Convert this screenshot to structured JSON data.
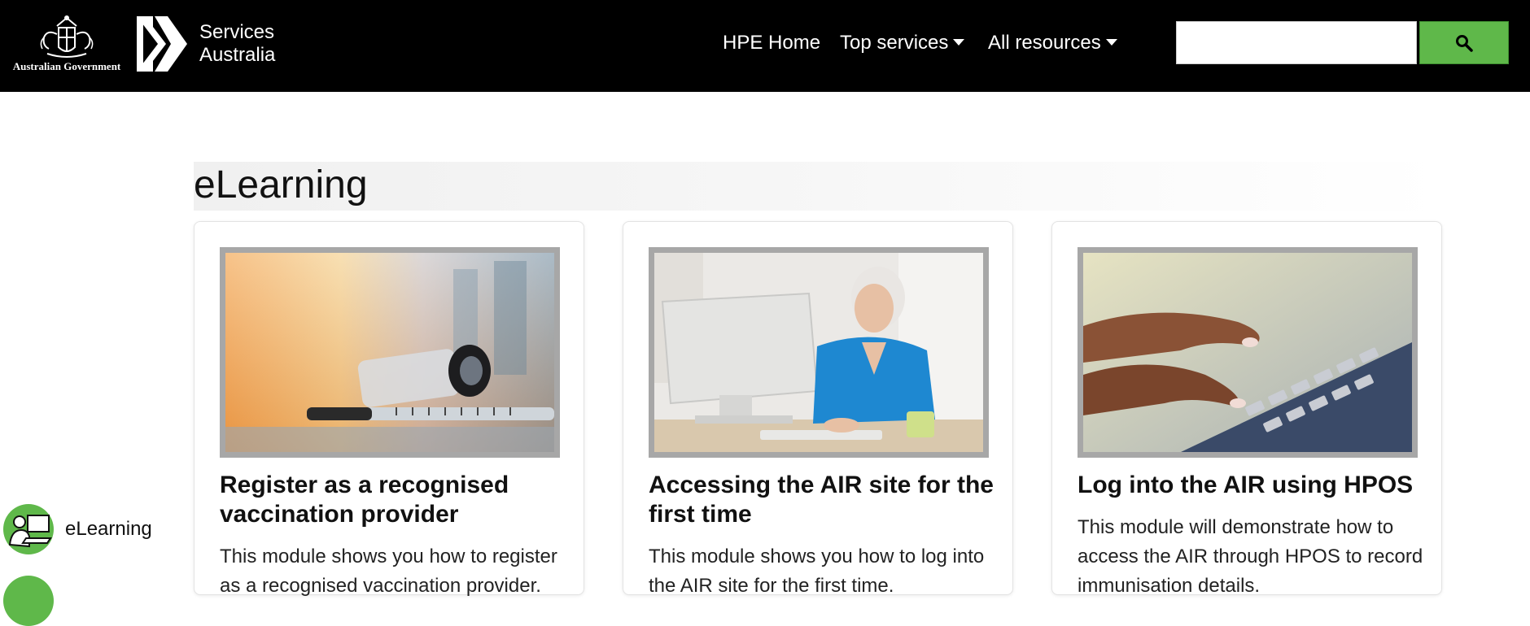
{
  "header": {
    "gov_logo_text": "Australian Government",
    "services_logo_line1": "Services",
    "services_logo_line2": "Australia",
    "nav": [
      {
        "label": "HPE Home",
        "dropdown": false
      },
      {
        "label": "Top services",
        "dropdown": true
      },
      {
        "label": "All resources",
        "dropdown": true
      }
    ],
    "search": {
      "value": "",
      "placeholder": "",
      "icon": "search-icon"
    }
  },
  "main": {
    "title": "eLearning",
    "cards": [
      {
        "title": "Register as a recognised vaccination provider",
        "text": "This module shows you how to register as a recognised vaccination provider.",
        "image": "vaccine-vial-syringe-photo"
      },
      {
        "title": "Accessing the AIR site for the first time",
        "text": "This module shows you how to log into the AIR site for the first time.",
        "image": "woman-at-computer-photo"
      },
      {
        "title": "Log into the AIR using HPOS",
        "text": "This module will demonstrate how to access the AIR through HPOS to record immunisation details.",
        "image": "hands-typing-keyboard-photo"
      }
    ]
  },
  "side_nav": {
    "items": [
      {
        "label": "eLearning",
        "icon": "elearning-icon"
      }
    ]
  },
  "colors": {
    "header_bg": "#000000",
    "accent_green": "#5fb84a",
    "image_border": "#a7a7a7"
  }
}
